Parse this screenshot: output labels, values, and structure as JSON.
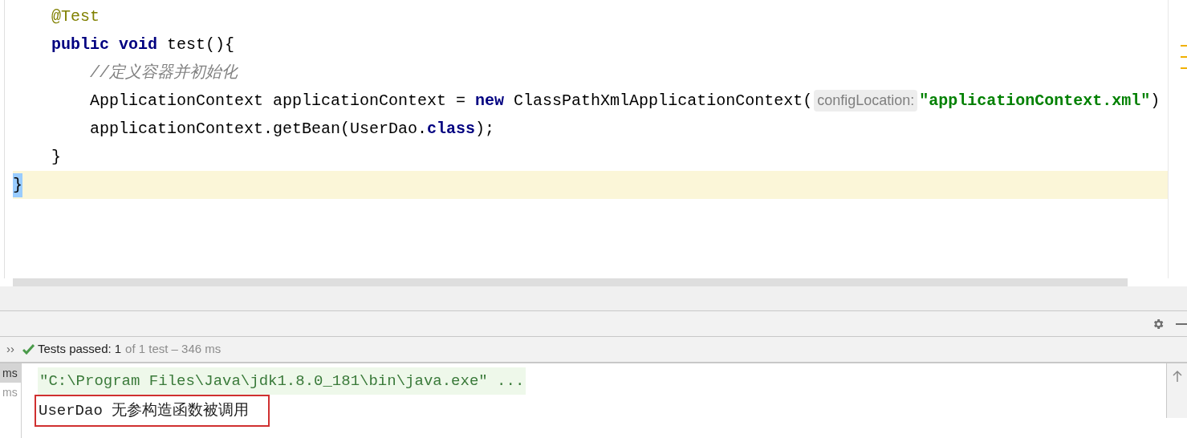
{
  "editor": {
    "lines": [
      {
        "children": [
          {
            "current": false,
            "tokens": [
              {
                "kind": "annotation",
                "text": "@Test"
              }
            ]
          },
          {
            "current": false,
            "tokens": [
              {
                "kind": "keyword",
                "text": "public"
              },
              {
                "kind": "keyword",
                "text": "void",
                "space_before": true
              },
              {
                "kind": "plain",
                "text": "test(){",
                "space_before": true
              }
            ],
            "children": [
              {
                "current": false,
                "tokens": [
                  {
                    "kind": "comment",
                    "text": "//定义容器并初始化"
                  }
                ]
              },
              {
                "current": false,
                "tokens": [
                  {
                    "kind": "plain",
                    "text": "ApplicationContext applicationContext ="
                  },
                  {
                    "kind": "keyword",
                    "text": "new",
                    "space_before": true
                  },
                  {
                    "kind": "plain",
                    "text": "ClassPathXmlApplicationContext(",
                    "space_before": true
                  },
                  {
                    "kind": "hint",
                    "text": "configLocation:"
                  },
                  {
                    "kind": "string",
                    "text": "\"applicationContext.xml\""
                  },
                  {
                    "kind": "plain",
                    "text": ")"
                  }
                ]
              },
              {
                "current": false,
                "tokens": [
                  {
                    "kind": "plain",
                    "text": "applicationContext.getBean(UserDao."
                  },
                  {
                    "kind": "keyword",
                    "text": "class"
                  },
                  {
                    "kind": "plain",
                    "text": ");"
                  }
                ]
              }
            ]
          },
          {
            "current": false,
            "tokens": [
              {
                "kind": "plain",
                "text": "}"
              }
            ]
          }
        ]
      },
      {
        "current": true,
        "tokens": [
          {
            "kind": "brace_match",
            "text": "}"
          }
        ]
      }
    ]
  },
  "status": {
    "expand": "››",
    "passed_label": "Tests passed:",
    "passed_count": "1",
    "summary": "of 1 test – 346 ms"
  },
  "console": {
    "gutter": [
      {
        "text": "ms",
        "selected": true
      },
      {
        "text": "ms",
        "selected": false
      }
    ],
    "lines": [
      {
        "kind": "command",
        "boxed": false,
        "text": "\"C:\\Program Files\\Java\\jdk1.8.0_181\\bin\\java.exe\" ..."
      },
      {
        "kind": "output",
        "boxed": true,
        "text": "UserDao 无参构造函数被调用"
      }
    ]
  }
}
